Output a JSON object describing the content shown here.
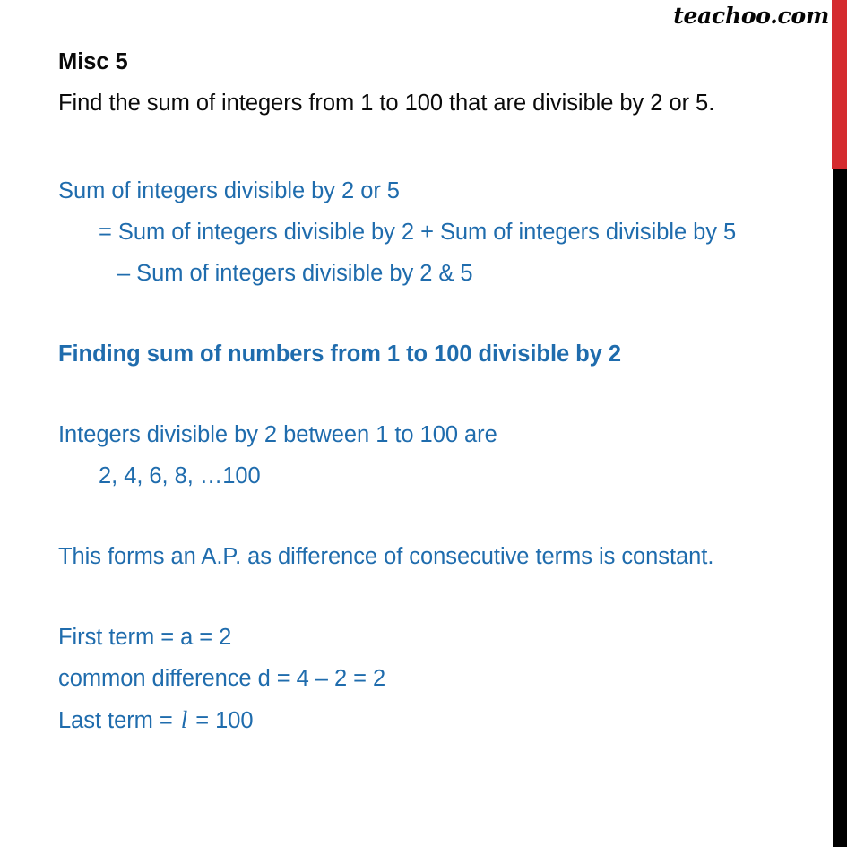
{
  "watermark": {
    "text": "teachoo.com"
  },
  "colors": {
    "edge_red": "#D42B2F",
    "edge_black": "#000000",
    "heading_black": "#0A0A0A",
    "body_blue": "#1F6CAD",
    "page_background": "#FFFFFF"
  },
  "document": {
    "title": "Misc 5",
    "question": "Find the sum of integers from 1 to 100 that are divisible by 2 or 5.",
    "solution": {
      "statement_line_1": "Sum of integers divisible by 2 or 5",
      "statement_line_2": "= Sum of integers divisible by 2 + Sum of integers divisible by 5",
      "statement_line_3": "– Sum of integers divisible by 2  & 5",
      "section_heading": "Finding sum of numbers from 1 to 100 divisible by 2",
      "series_intro": "Integers divisible by 2 between 1 to 100 are",
      "series_terms": "2, 4, 6, 8, …100",
      "ap_note": "This forms an A.P. as difference of consecutive terms is constant.",
      "first_term": "First term = a = 2",
      "common_difference": "common difference d = 4 – 2   = 2",
      "last_term_prefix": "Last term = ",
      "last_term_symbol": "l",
      "last_term_suffix": " = 100"
    }
  }
}
